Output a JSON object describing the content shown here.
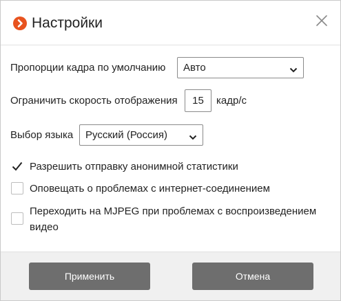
{
  "dialog": {
    "title": "Настройки",
    "logo_icon": "chevron-right-circle-icon",
    "close_icon": "close-icon",
    "accent_color": "#e8531f"
  },
  "settings": {
    "aspect_ratio": {
      "label": "Пропорции кадра по умолчанию",
      "value": "Авто"
    },
    "frame_rate": {
      "label": "Ограничить скорость отображения",
      "value": "15",
      "unit": "кадр/с"
    },
    "language": {
      "label": "Выбор языка",
      "value": "Русский (Россия)"
    },
    "checkboxes": [
      {
        "label": "Разрешить отправку анонимной статистики",
        "checked": true
      },
      {
        "label": "Оповещать о проблемах с интернет-соединением",
        "checked": false
      },
      {
        "label_line1": "Переходить на MJPEG при проблемах с воспроизведением",
        "label_line2": "видео",
        "checked": false
      }
    ]
  },
  "footer": {
    "apply_label": "Применить",
    "cancel_label": "Отмена",
    "button_color": "#6e6e6e"
  }
}
